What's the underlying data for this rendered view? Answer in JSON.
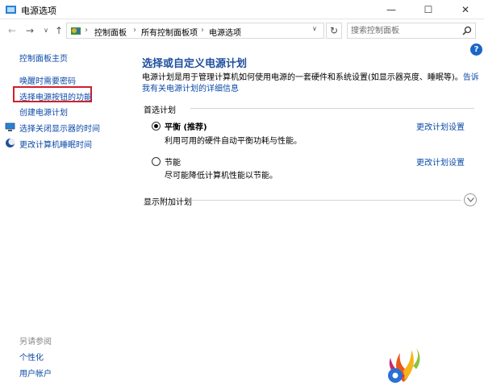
{
  "window": {
    "title": "电源选项",
    "min_glyph": "—",
    "max_glyph": "☐",
    "close_glyph": "✕"
  },
  "address": {
    "back_glyph": "←",
    "forward_glyph": "→",
    "dropdown_glyph": "∨",
    "up_glyph": "↑",
    "breadcrumb_sep": "›",
    "breadcrumbs": [
      "控制面板",
      "所有控制面板项",
      "电源选项"
    ],
    "refresh_glyph": "↻",
    "search_placeholder": "搜索控制面板"
  },
  "help_glyph": "?",
  "sidebar": {
    "home": "控制面板主页",
    "items": [
      "唤醒时需要密码",
      "选择电源按钮的功能",
      "创建电源计划",
      "选择关闭显示器的时间",
      "更改计算机睡眠时间"
    ],
    "see_also_label": "另请参阅",
    "see_also": [
      "个性化",
      "用户帐户"
    ]
  },
  "main": {
    "title": "选择或自定义电源计划",
    "description": "电源计划是用于管理计算机如何使用电源的一套硬件和系统设置(如显示器亮度、睡眠等)。",
    "description_link": "告诉我有关电源计划的详细信息",
    "preferred_label": "首选计划",
    "plans": [
      {
        "name": "平衡 (推荐)",
        "description": "利用可用的硬件自动平衡功耗与性能。",
        "link": "更改计划设置",
        "selected": true
      },
      {
        "name": "节能",
        "description": "尽可能降低计算机性能以节能。",
        "link": "更改计划设置",
        "selected": false
      }
    ],
    "more_plans_label": "显示附加计划"
  },
  "colors": {
    "link": "#0b4aa8",
    "title": "#1e4f9e",
    "highlight": "#d0202a"
  }
}
